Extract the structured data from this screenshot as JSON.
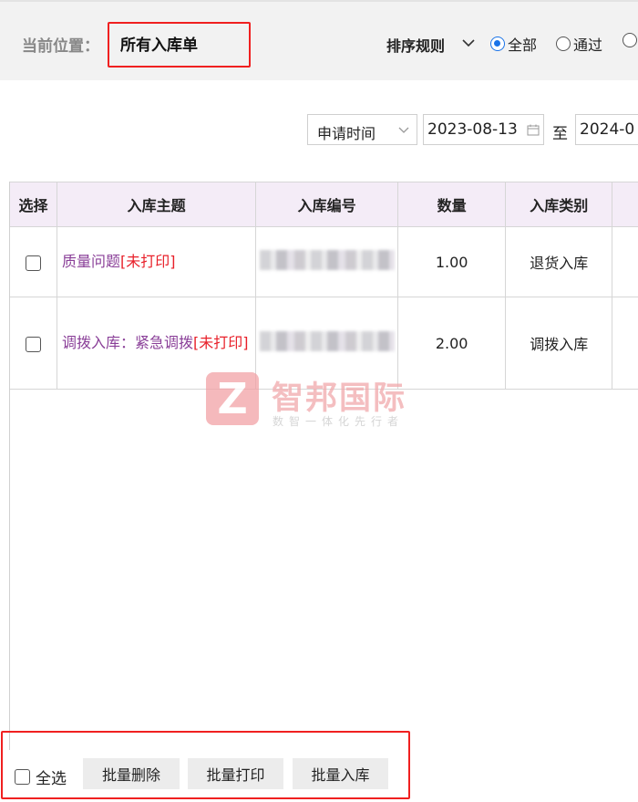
{
  "header": {
    "location_label": "当前位置：",
    "location_value": "所有入库单",
    "sort_label": "排序规则",
    "radios": [
      {
        "label": "全部",
        "selected": true
      },
      {
        "label": "通过",
        "selected": false
      },
      {
        "label": "",
        "selected": false
      }
    ]
  },
  "filter": {
    "date_field": "申请时间",
    "start_date": "2023-08-13",
    "to_label": "至",
    "end_date": "2024-0"
  },
  "table": {
    "columns": [
      "选择",
      "入库主题",
      "入库编号",
      "数量",
      "入库类别"
    ],
    "rows": [
      {
        "subject": "质量问题",
        "tag": "[未打印]",
        "number": "",
        "quantity": "1.00",
        "category": "退货入库"
      },
      {
        "subject": "调拨入库：紧急调拨",
        "tag": "[未打印]",
        "number": "",
        "quantity": "2.00",
        "category": "调拨入库"
      }
    ]
  },
  "watermark": {
    "logo_letter": "Z",
    "title": "智邦国际",
    "subtitle": "数智一体化先行者"
  },
  "footer": {
    "select_all": "全选",
    "buttons": [
      "批量删除",
      "批量打印",
      "批量入库"
    ]
  },
  "colors": {
    "header_bg": "#f2f2f2",
    "table_header_bg": "#f4ecf7",
    "subject_link": "#8a3f98",
    "unprinted_tag": "#e8202a",
    "highlight_box": "#f02020",
    "radio_accent": "#1a73e8"
  }
}
